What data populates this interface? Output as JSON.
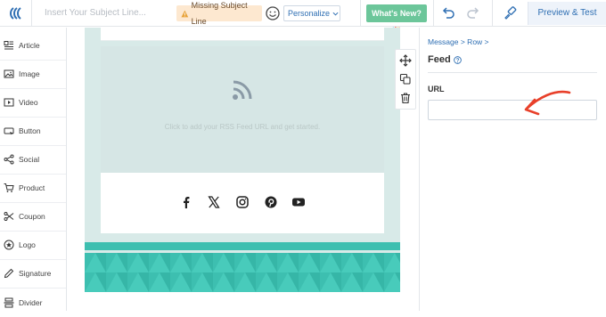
{
  "topbar": {
    "subject_placeholder": "Insert Your Subject Line...",
    "warning_label": "Missing Subject Line",
    "personalize_label": "Personalize",
    "whats_new_label": "What's New? 🎉",
    "preview_label": "Preview & Test"
  },
  "sidebar": {
    "items": [
      {
        "label": "Article",
        "icon": "article-icon"
      },
      {
        "label": "Image",
        "icon": "image-icon"
      },
      {
        "label": "Video",
        "icon": "video-icon"
      },
      {
        "label": "Button",
        "icon": "button-icon"
      },
      {
        "label": "Social",
        "icon": "share-icon"
      },
      {
        "label": "Product",
        "icon": "cart-icon"
      },
      {
        "label": "Coupon",
        "icon": "scissors-icon"
      },
      {
        "label": "Logo",
        "icon": "star-icon"
      },
      {
        "label": "Signature",
        "icon": "pen-icon"
      },
      {
        "label": "Divider",
        "icon": "divider-icon"
      }
    ]
  },
  "canvas": {
    "rss_hint": "Click to add your RSS Feed URL and get started.",
    "social_icons": [
      "facebook-icon",
      "x-icon",
      "instagram-icon",
      "pinterest-icon",
      "youtube-icon"
    ]
  },
  "panel": {
    "breadcrumb": "Message  >  Row  >",
    "title": "Feed",
    "url_label": "URL",
    "url_value": ""
  },
  "colors": {
    "accent": "#2f6fb3",
    "teal": "#3dbfb0",
    "warning_bg": "#fde8d0",
    "whats_new_bg": "#6cc69a",
    "arrow": "#e8402a"
  }
}
